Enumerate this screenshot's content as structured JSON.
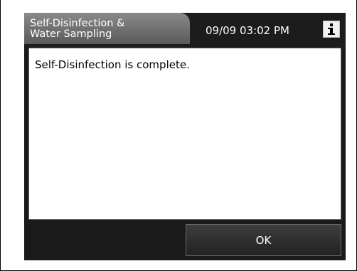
{
  "header": {
    "title_line1": "Self-Disinfection &",
    "title_line2": "Water Sampling",
    "datetime": "09/09 03:02 PM",
    "info_icon": "info-icon"
  },
  "message": {
    "text": "Self-Disinfection is complete."
  },
  "footer": {
    "ok_label": "OK"
  },
  "colors": {
    "screen_bg": "#1a1a1a",
    "title_tab": "#7a7a7a",
    "panel_bg": "#ffffff",
    "button_bg": "#303030"
  }
}
